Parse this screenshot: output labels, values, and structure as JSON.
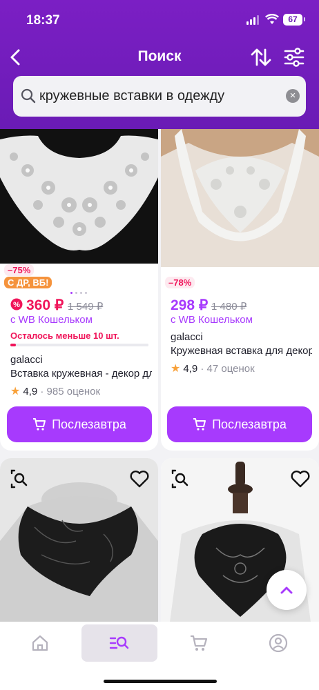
{
  "status": {
    "time": "18:37",
    "battery": "67"
  },
  "nav": {
    "title": "Поиск"
  },
  "search": {
    "query": "кружевные вставки в одежду"
  },
  "products": [
    {
      "discount_badge": "–75%",
      "promo_badge": "С ДР, ВБ!",
      "price": "360 ₽",
      "old_price": "1 549 ₽",
      "wallet": "с WB Кошельком",
      "stock_note": "Осталось меньше 10 шт.",
      "stock_level": 0.04,
      "brand": "galacci",
      "name": "Вставка кружевная - декор для",
      "rating": "4,9",
      "reviews": "985 оценок",
      "buy_label": "Послезавтра"
    },
    {
      "discount_badge": "–78%",
      "price": "298 ₽",
      "old_price": "1 480 ₽",
      "wallet": "с WB Кошельком",
      "brand": "galacci",
      "name": "Кружевная вставка для декора",
      "rating": "4,9",
      "reviews": "47 оценок",
      "buy_label": "Послезавтра"
    }
  ],
  "colors": {
    "brand": "#6a1bb5",
    "accent": "#a73afd",
    "sale": "#f0155a"
  },
  "tabs": [
    "home-icon",
    "catalog-search-icon",
    "cart-icon",
    "profile-icon"
  ]
}
